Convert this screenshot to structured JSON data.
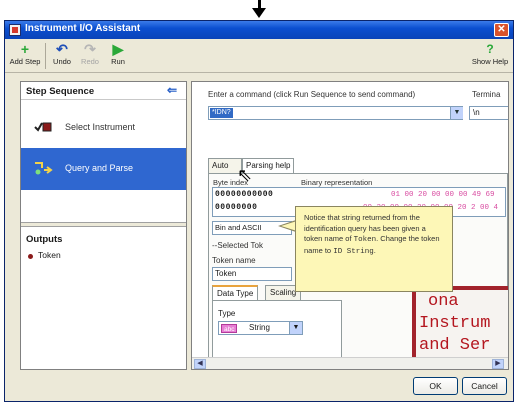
{
  "window": {
    "title": "Instrument I/O Assistant",
    "close_glyph": "✕"
  },
  "toolbar": {
    "add_step": "Add Step",
    "undo": "Undo",
    "redo": "Redo",
    "run": "Run",
    "show_help": "Show Help"
  },
  "left_pane": {
    "step_sequence_title": "Step Sequence",
    "steps": [
      {
        "label": "Select Instrument",
        "selected": false
      },
      {
        "label": "Query and Parse",
        "selected": true
      }
    ],
    "outputs_title": "Outputs",
    "outputs": [
      "Token"
    ]
  },
  "right_pane": {
    "command_label": "Enter a command (click Run Sequence to send command)",
    "command_value": "*IDN?",
    "terminator_label": "Termina",
    "terminator_value": "\\n",
    "tabs": [
      "Auto",
      "Parsing help"
    ],
    "col_bytes": "Byte index",
    "col_binary": "Binary representation",
    "binary_rows": [
      "00000000000",
      "00000000"
    ],
    "binary_pink": [
      "01 00 20 00 00 00 49 69",
      "00 20 00 00 20 00 00 20 2 00 4"
    ],
    "parse_mode": "Bin and ASCII",
    "selected_token_label": "--Selected Tok",
    "token_name_label": "Token name",
    "token_name_value": "Token",
    "sub_tabs": [
      "Data Type",
      "Scaling"
    ],
    "type_label": "Type",
    "type_badge": "abc",
    "type_value": "String",
    "serif_lines": [
      "ona",
      "Instrum",
      "and Ser"
    ]
  },
  "callout": {
    "text_1": "Notice that string returned from the identification query has been given a token name of ",
    "mono_1": "Token",
    "text_2": ". Change the token name to ",
    "mono_2": "ID String",
    "text_3": "."
  },
  "buttons": {
    "ok": "OK",
    "cancel": "Cancel"
  },
  "colors": {
    "titlebar": "#0b4fd0",
    "selection": "#2f67d0",
    "callout": "#fdf7b7",
    "accent_red": "#b4161f"
  }
}
